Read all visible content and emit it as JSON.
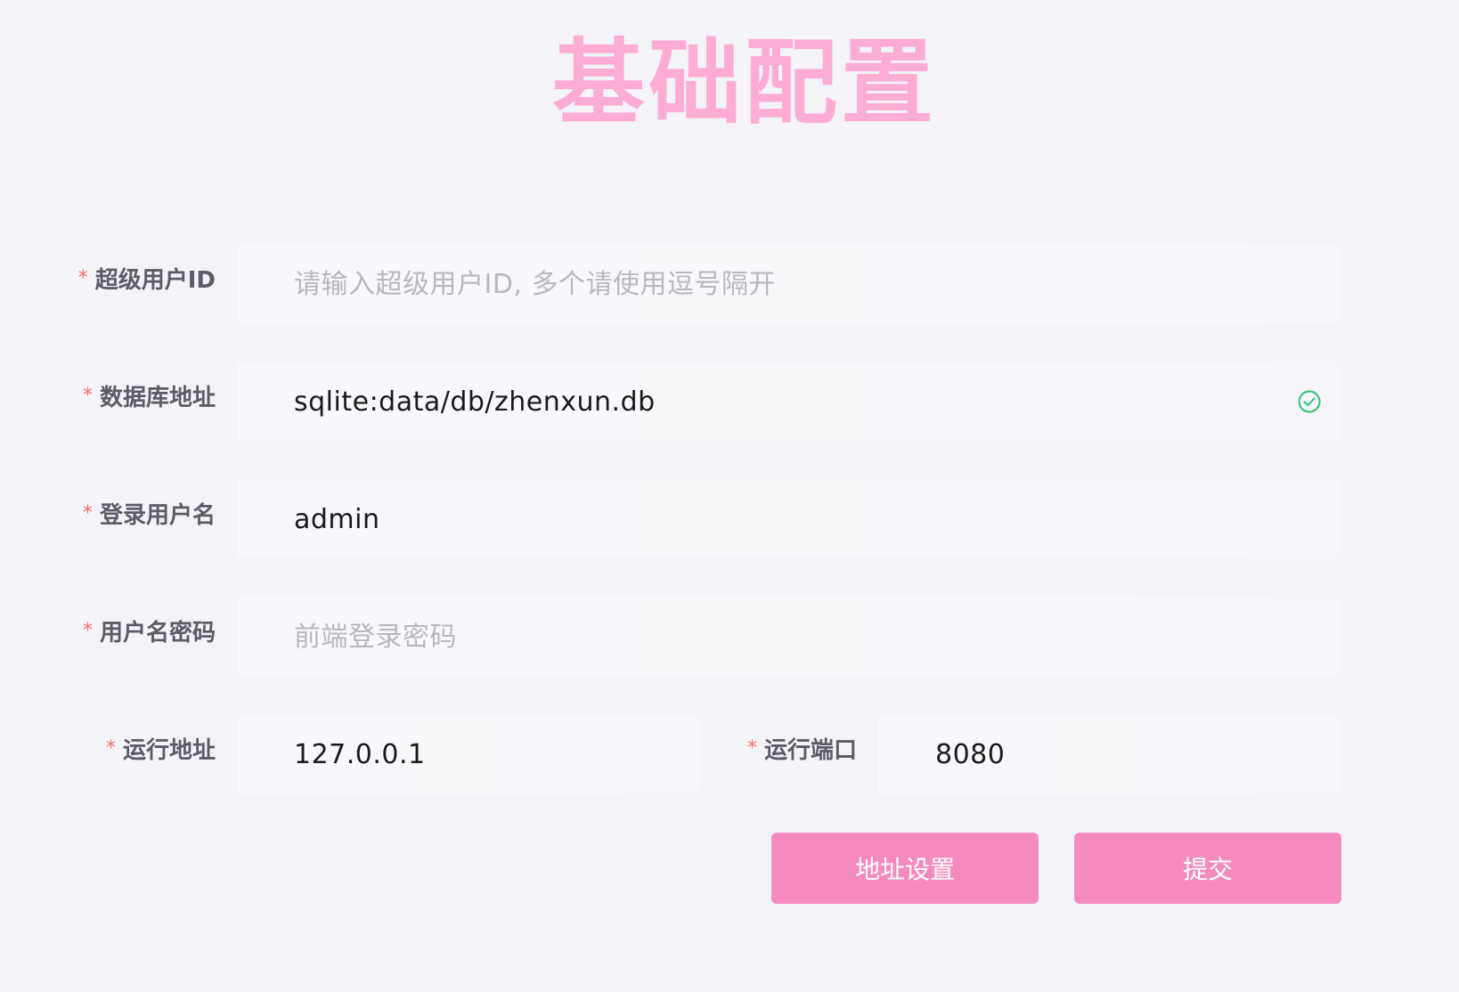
{
  "title": "基础配置",
  "fields": {
    "superuser": {
      "label": "超级用户ID",
      "value": "",
      "placeholder": "请输入超级用户ID, 多个请使用逗号隔开"
    },
    "db_url": {
      "label": "数据库地址",
      "value": "sqlite:data/db/zhenxun.db",
      "placeholder": "",
      "status_icon": "check-circle-icon"
    },
    "username": {
      "label": "登录用户名",
      "value": "admin",
      "placeholder": ""
    },
    "password": {
      "label": "用户名密码",
      "value": "",
      "placeholder": "前端登录密码"
    },
    "host": {
      "label": "运行地址",
      "value": "127.0.0.1",
      "placeholder": ""
    },
    "port": {
      "label": "运行端口",
      "value": "8080",
      "placeholder": ""
    }
  },
  "required_mark": "*",
  "buttons": {
    "address_settings": "地址设置",
    "submit": "提交"
  },
  "colors": {
    "title": "#fdacd4",
    "button": "#f58bbd",
    "required": "#f56c6c",
    "success": "#3ec47c",
    "background": "#f4f4f8"
  }
}
